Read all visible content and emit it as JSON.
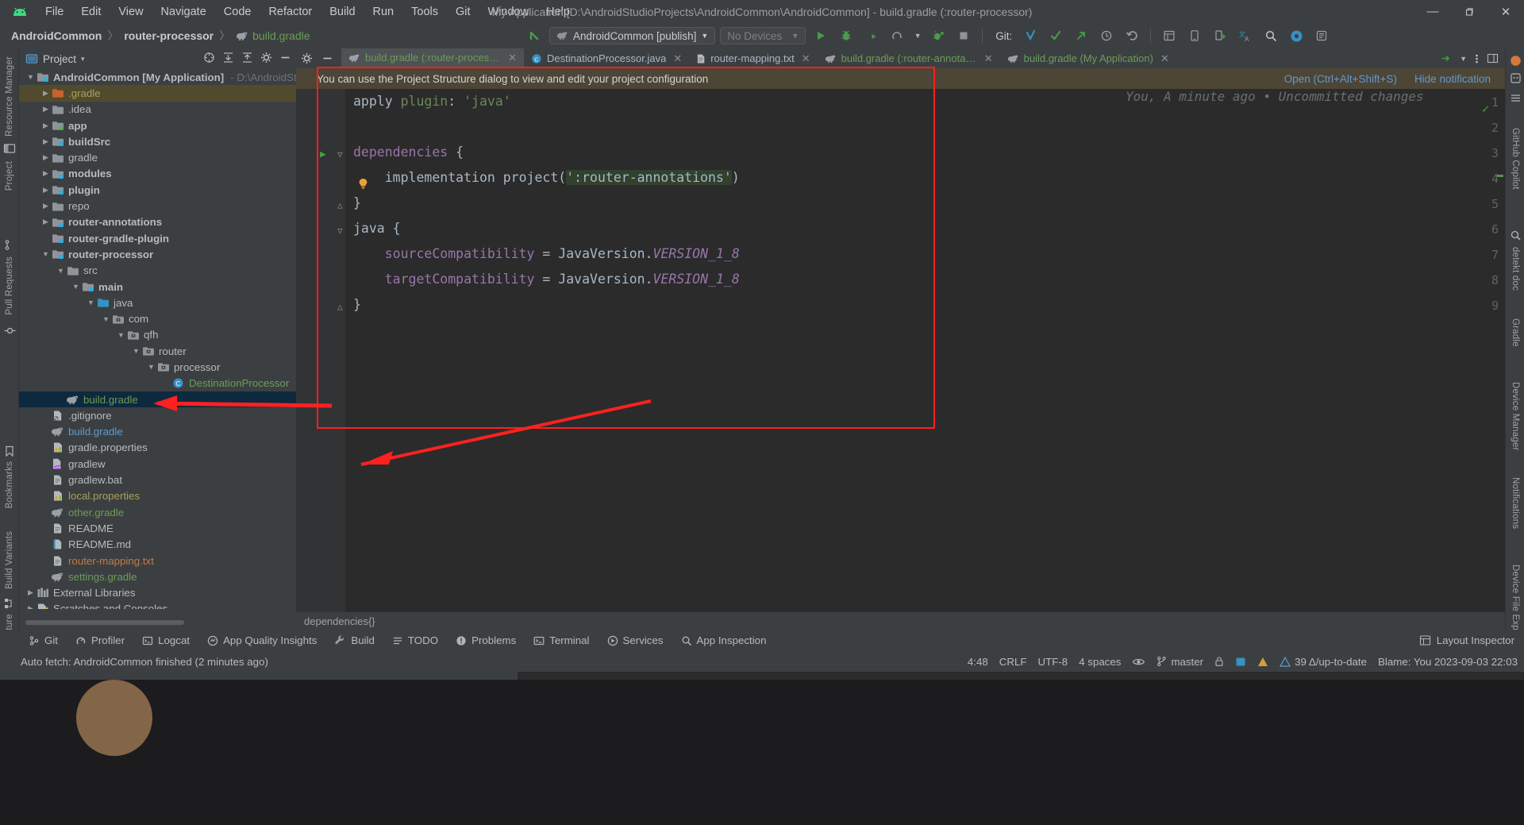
{
  "window": {
    "title": "My Application [D:\\AndroidStudioProjects\\AndroidCommon\\AndroidCommon] - build.gradle (:router-processor)",
    "minimize": "—",
    "maximize": "❐",
    "close": "✕"
  },
  "menu": {
    "items": [
      "File",
      "Edit",
      "View",
      "Navigate",
      "Code",
      "Refactor",
      "Build",
      "Run",
      "Tools",
      "Git",
      "Window",
      "Help"
    ]
  },
  "breadcrumbs": {
    "project": "AndroidCommon",
    "module": "router-processor",
    "file": "build.gradle",
    "separator": "〉"
  },
  "toolbar": {
    "run_config": "AndroidCommon [publish]",
    "devices": "No Devices",
    "dropdown_caret": "▼",
    "git_label": "Git:",
    "icons": [
      "back-arrow-icon",
      "run-icon",
      "debug-icon",
      "run-coverage-icon",
      "profile-icon",
      "attach-debugger-icon",
      "stop-icon",
      "git-update-icon",
      "git-commit-icon",
      "git-push-icon",
      "history-icon",
      "undo-icon",
      "layout-inspector-icon",
      "device-manager-icon",
      "device-explorer-icon",
      "translate-icon",
      "search-icon",
      "settings-icon",
      "notification-icon"
    ]
  },
  "project_panel": {
    "title": "Project",
    "caret": "▾",
    "header_icons": [
      "select-opened-file-icon",
      "expand-all-icon",
      "collapse-all-icon",
      "settings-gear-icon",
      "hide-icon"
    ],
    "tree": [
      {
        "depth": 0,
        "arrow": "down",
        "icon": "module-folder",
        "label": "AndroidCommon [My Application]",
        "suffix": "- D:\\AndroidSt",
        "bold": true,
        "color": "#b7bbbe",
        "state": "normal"
      },
      {
        "depth": 1,
        "arrow": "right",
        "icon": "folder-orange",
        "label": ".gradle",
        "color": "#a9a058",
        "state": "highlight"
      },
      {
        "depth": 1,
        "arrow": "right",
        "icon": "folder",
        "label": ".idea",
        "color": "#b7bbbe",
        "state": "normal"
      },
      {
        "depth": 1,
        "arrow": "right",
        "icon": "module-folder-green",
        "label": "app",
        "bold": true,
        "color": "#b7bbbe",
        "state": "normal"
      },
      {
        "depth": 1,
        "arrow": "right",
        "icon": "module-folder",
        "label": "buildSrc",
        "bold": true,
        "color": "#b7bbbe",
        "state": "normal"
      },
      {
        "depth": 1,
        "arrow": "right",
        "icon": "folder",
        "label": "gradle",
        "color": "#b7bbbe",
        "state": "normal"
      },
      {
        "depth": 1,
        "arrow": "right",
        "icon": "module-folder",
        "label": "modules",
        "bold": true,
        "color": "#b7bbbe",
        "state": "normal"
      },
      {
        "depth": 1,
        "arrow": "right",
        "icon": "module-folder",
        "label": "plugin",
        "bold": true,
        "color": "#b7bbbe",
        "state": "normal"
      },
      {
        "depth": 1,
        "arrow": "right",
        "icon": "folder",
        "label": "repo",
        "color": "#b7bbbe",
        "state": "normal"
      },
      {
        "depth": 1,
        "arrow": "right",
        "icon": "module-folder",
        "label": "router-annotations",
        "bold": true,
        "color": "#b7bbbe",
        "state": "normal"
      },
      {
        "depth": 1,
        "arrow": "blank",
        "icon": "module-folder",
        "label": "router-gradle-plugin",
        "bold": true,
        "color": "#b7bbbe",
        "state": "normal"
      },
      {
        "depth": 1,
        "arrow": "down",
        "icon": "module-folder",
        "label": "router-processor",
        "bold": true,
        "color": "#b7bbbe",
        "state": "normal"
      },
      {
        "depth": 2,
        "arrow": "down",
        "icon": "folder",
        "label": "src",
        "color": "#b7bbbe",
        "state": "normal"
      },
      {
        "depth": 3,
        "arrow": "down",
        "icon": "module-folder",
        "label": "main",
        "bold": true,
        "color": "#b7bbbe",
        "state": "normal"
      },
      {
        "depth": 4,
        "arrow": "down",
        "icon": "folder-blue",
        "label": "java",
        "color": "#b7bbbe",
        "state": "normal"
      },
      {
        "depth": 5,
        "arrow": "down",
        "icon": "package",
        "label": "com",
        "color": "#b7bbbe",
        "state": "normal"
      },
      {
        "depth": 6,
        "arrow": "down",
        "icon": "package",
        "label": "qfh",
        "color": "#b7bbbe",
        "state": "normal"
      },
      {
        "depth": 7,
        "arrow": "down",
        "icon": "package",
        "label": "router",
        "color": "#b7bbbe",
        "state": "normal"
      },
      {
        "depth": 8,
        "arrow": "down",
        "icon": "package",
        "label": "processor",
        "color": "#b7bbbe",
        "state": "normal"
      },
      {
        "depth": 9,
        "arrow": "blank",
        "icon": "class",
        "label": "DestinationProcessor",
        "color": "#6a9c5a",
        "state": "normal"
      },
      {
        "depth": 2,
        "arrow": "blank",
        "icon": "gradle",
        "label": "build.gradle",
        "color": "#6a9c5a",
        "state": "selected"
      },
      {
        "depth": 1,
        "arrow": "blank",
        "icon": "gitignore",
        "label": ".gitignore",
        "color": "#b7bbbe",
        "state": "normal"
      },
      {
        "depth": 1,
        "arrow": "blank",
        "icon": "gradle",
        "label": "build.gradle",
        "color": "#5f9ad1",
        "state": "normal"
      },
      {
        "depth": 1,
        "arrow": "blank",
        "icon": "properties",
        "label": "gradle.properties",
        "color": "#b7bbbe",
        "state": "normal"
      },
      {
        "depth": 1,
        "arrow": "blank",
        "icon": "cpp",
        "label": "gradlew",
        "color": "#b7bbbe",
        "state": "normal"
      },
      {
        "depth": 1,
        "arrow": "blank",
        "icon": "file",
        "label": "gradlew.bat",
        "color": "#b7bbbe",
        "state": "normal"
      },
      {
        "depth": 1,
        "arrow": "blank",
        "icon": "properties",
        "label": "local.properties",
        "color": "#a9a058",
        "state": "normal"
      },
      {
        "depth": 1,
        "arrow": "blank",
        "icon": "gradle",
        "label": "other.gradle",
        "color": "#6a9c5a",
        "state": "normal"
      },
      {
        "depth": 1,
        "arrow": "blank",
        "icon": "file",
        "label": "README",
        "color": "#b7bbbe",
        "state": "normal"
      },
      {
        "depth": 1,
        "arrow": "blank",
        "icon": "markdown",
        "label": "README.md",
        "color": "#b7bbbe",
        "state": "normal"
      },
      {
        "depth": 1,
        "arrow": "blank",
        "icon": "file",
        "label": "router-mapping.txt",
        "color": "#c07a4a",
        "state": "normal"
      },
      {
        "depth": 1,
        "arrow": "blank",
        "icon": "gradle",
        "label": "settings.gradle",
        "color": "#6a9c5a",
        "state": "normal"
      },
      {
        "depth": 0,
        "arrow": "right",
        "icon": "libraries",
        "label": "External Libraries",
        "color": "#b7bbbe",
        "state": "normal"
      },
      {
        "depth": 0,
        "arrow": "right",
        "icon": "scratches",
        "label": "Scratches and Consoles",
        "color": "#b7bbbe",
        "state": "normal"
      }
    ]
  },
  "left_stripe": {
    "items": [
      "Resource Manager",
      "Project",
      "Pull Requests",
      "Commit",
      "Bookmarks",
      "Build Variants",
      "Structure"
    ]
  },
  "right_stripe": {
    "items": [
      "GitHub Copilot",
      "detekt doc",
      "Gradle",
      "Device Manager",
      "Notifications",
      "Device File Explorer"
    ]
  },
  "editor": {
    "tabs": [
      {
        "label": "build.gradle (:router-processor)",
        "icon": "gradle-icon",
        "color": "#6a9c5a",
        "active": true
      },
      {
        "label": "DestinationProcessor.java",
        "icon": "class-icon",
        "color": "#a9b7c6",
        "active": false
      },
      {
        "label": "router-mapping.txt",
        "icon": "text-icon",
        "color": "#a9b7c6",
        "active": false
      },
      {
        "label": "build.gradle (:router-annotations)",
        "icon": "gradle-icon",
        "color": "#6a9c5a",
        "active": false
      },
      {
        "label": "build.gradle (My Application)",
        "icon": "gradle-icon",
        "color": "#6a9c5a",
        "active": false
      }
    ],
    "tab_close": "✕",
    "notification": {
      "text": "You can use the Project Structure dialog to view and edit your project configuration",
      "open_action": "Open (Ctrl+Alt+Shift+S)",
      "hide_action": "Hide notification"
    },
    "line_numbers": [
      "1",
      "2",
      "3",
      "4",
      "5",
      "6",
      "7",
      "8",
      "9"
    ],
    "code_lines": [
      {
        "n": "1",
        "tokens": [
          {
            "t": "apply ",
            "c": "plain"
          },
          {
            "t": "plugin",
            "c": "prop"
          },
          {
            "t": ": ",
            "c": "plain"
          },
          {
            "t": "'java'",
            "c": "str"
          }
        ]
      },
      {
        "n": "2",
        "tokens": []
      },
      {
        "n": "3",
        "tokens": [
          {
            "t": "dependencies ",
            "c": "gfn"
          },
          {
            "t": "{",
            "c": "plain"
          }
        ]
      },
      {
        "n": "4",
        "tokens": [
          {
            "t": "    implementation project(",
            "c": "plain"
          },
          {
            "t": "':router-annotations'",
            "c": "hlstr"
          },
          {
            "t": ")",
            "c": "plain"
          }
        ]
      },
      {
        "n": "5",
        "tokens": [
          {
            "t": "}",
            "c": "plain"
          }
        ]
      },
      {
        "n": "6",
        "tokens": [
          {
            "t": "java ",
            "c": "plain"
          },
          {
            "t": "{",
            "c": "plain"
          }
        ]
      },
      {
        "n": "7",
        "tokens": [
          {
            "t": "    sourceCompatibility ",
            "c": "gfn"
          },
          {
            "t": "= ",
            "c": "plain"
          },
          {
            "t": "JavaVersion.",
            "c": "plain"
          },
          {
            "t": "VERSION_1_8",
            "c": "fld"
          }
        ]
      },
      {
        "n": "8",
        "tokens": [
          {
            "t": "    targetCompatibility ",
            "c": "gfn"
          },
          {
            "t": "= ",
            "c": "plain"
          },
          {
            "t": "JavaVersion.",
            "c": "plain"
          },
          {
            "t": "VERSION_1_8",
            "c": "fld"
          }
        ]
      },
      {
        "n": "9",
        "tokens": [
          {
            "t": "}",
            "c": "plain"
          }
        ]
      }
    ],
    "vcs_annotation": "You, A minute ago • Uncommitted changes",
    "bottom_breadcrumb": "dependencies{}"
  },
  "bottom_toolbar": {
    "items": [
      {
        "label": "Git",
        "icon": "git-icon"
      },
      {
        "label": "Profiler",
        "icon": "profiler-icon"
      },
      {
        "label": "Logcat",
        "icon": "logcat-icon"
      },
      {
        "label": "App Quality Insights",
        "icon": "insights-icon"
      },
      {
        "label": "Build",
        "icon": "build-icon"
      },
      {
        "label": "TODO",
        "icon": "todo-icon"
      },
      {
        "label": "Problems",
        "icon": "problems-icon"
      },
      {
        "label": "Terminal",
        "icon": "terminal-icon"
      },
      {
        "label": "Services",
        "icon": "services-icon"
      },
      {
        "label": "App Inspection",
        "icon": "app-inspection-icon"
      }
    ],
    "right_label": "Layout Inspector"
  },
  "status_bar": {
    "message": "Auto fetch: AndroidCommon finished (2 minutes ago)",
    "caret": "4:48",
    "line_sep": "CRLF",
    "encoding": "UTF-8",
    "indent": "4 spaces",
    "branch": "master",
    "inspections": "39 Δ/up-to-date",
    "blame": "Blame: You 2023-09-03 22:03"
  },
  "colors": {
    "accent_green": "#4a9b4a",
    "selection_blue": "#0d293e",
    "annotation_red": "#ff2020",
    "notification_bg": "#4d4535",
    "editor_bg": "#2b2b2b",
    "panel_bg": "#3c3f41"
  }
}
